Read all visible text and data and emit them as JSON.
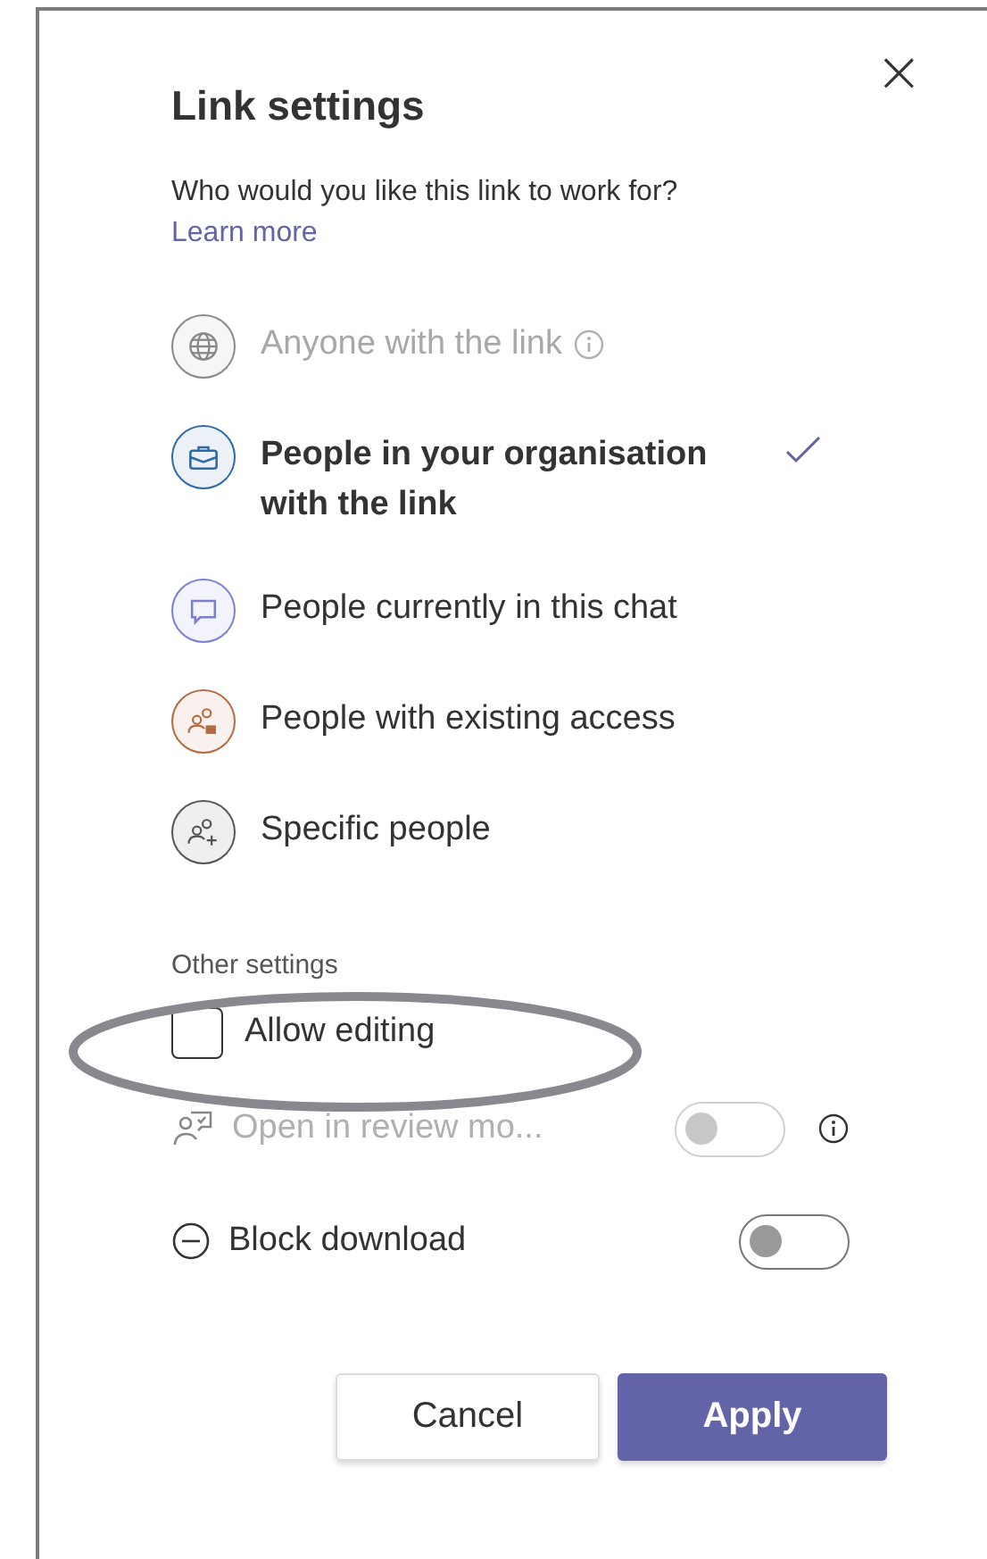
{
  "dialog": {
    "title": "Link settings",
    "close": "×",
    "question": "Who would you like this link to work for?",
    "learn_more": "Learn more"
  },
  "options": [
    {
      "label": "Anyone with the link",
      "selected": false,
      "disabled": true,
      "info": true,
      "color": "#8a8886"
    },
    {
      "label": "People in your organisation with the link",
      "selected": true,
      "disabled": false,
      "info": false,
      "color": "#2f6aa8"
    },
    {
      "label": "People currently in this chat",
      "selected": false,
      "disabled": false,
      "info": false,
      "color": "#7b7fd0"
    },
    {
      "label": "People with existing access",
      "selected": false,
      "disabled": false,
      "info": false,
      "color": "#b46b40"
    },
    {
      "label": "Specific people",
      "selected": false,
      "disabled": false,
      "info": false,
      "color": "#555555"
    }
  ],
  "other_settings": {
    "heading": "Other settings",
    "items": [
      {
        "kind": "checkbox",
        "label": "Allow editing",
        "checked": false
      },
      {
        "kind": "toggle",
        "label": "Open in review mo...",
        "on": false,
        "disabled": true,
        "info": true
      },
      {
        "kind": "toggle",
        "label": "Block download",
        "on": false,
        "disabled": false,
        "info": false
      }
    ]
  },
  "annotation": {
    "kind": "ellipse"
  },
  "buttons": [
    {
      "label": "Cancel",
      "kind": "secondary"
    },
    {
      "label": "Apply",
      "kind": "primary"
    }
  ]
}
